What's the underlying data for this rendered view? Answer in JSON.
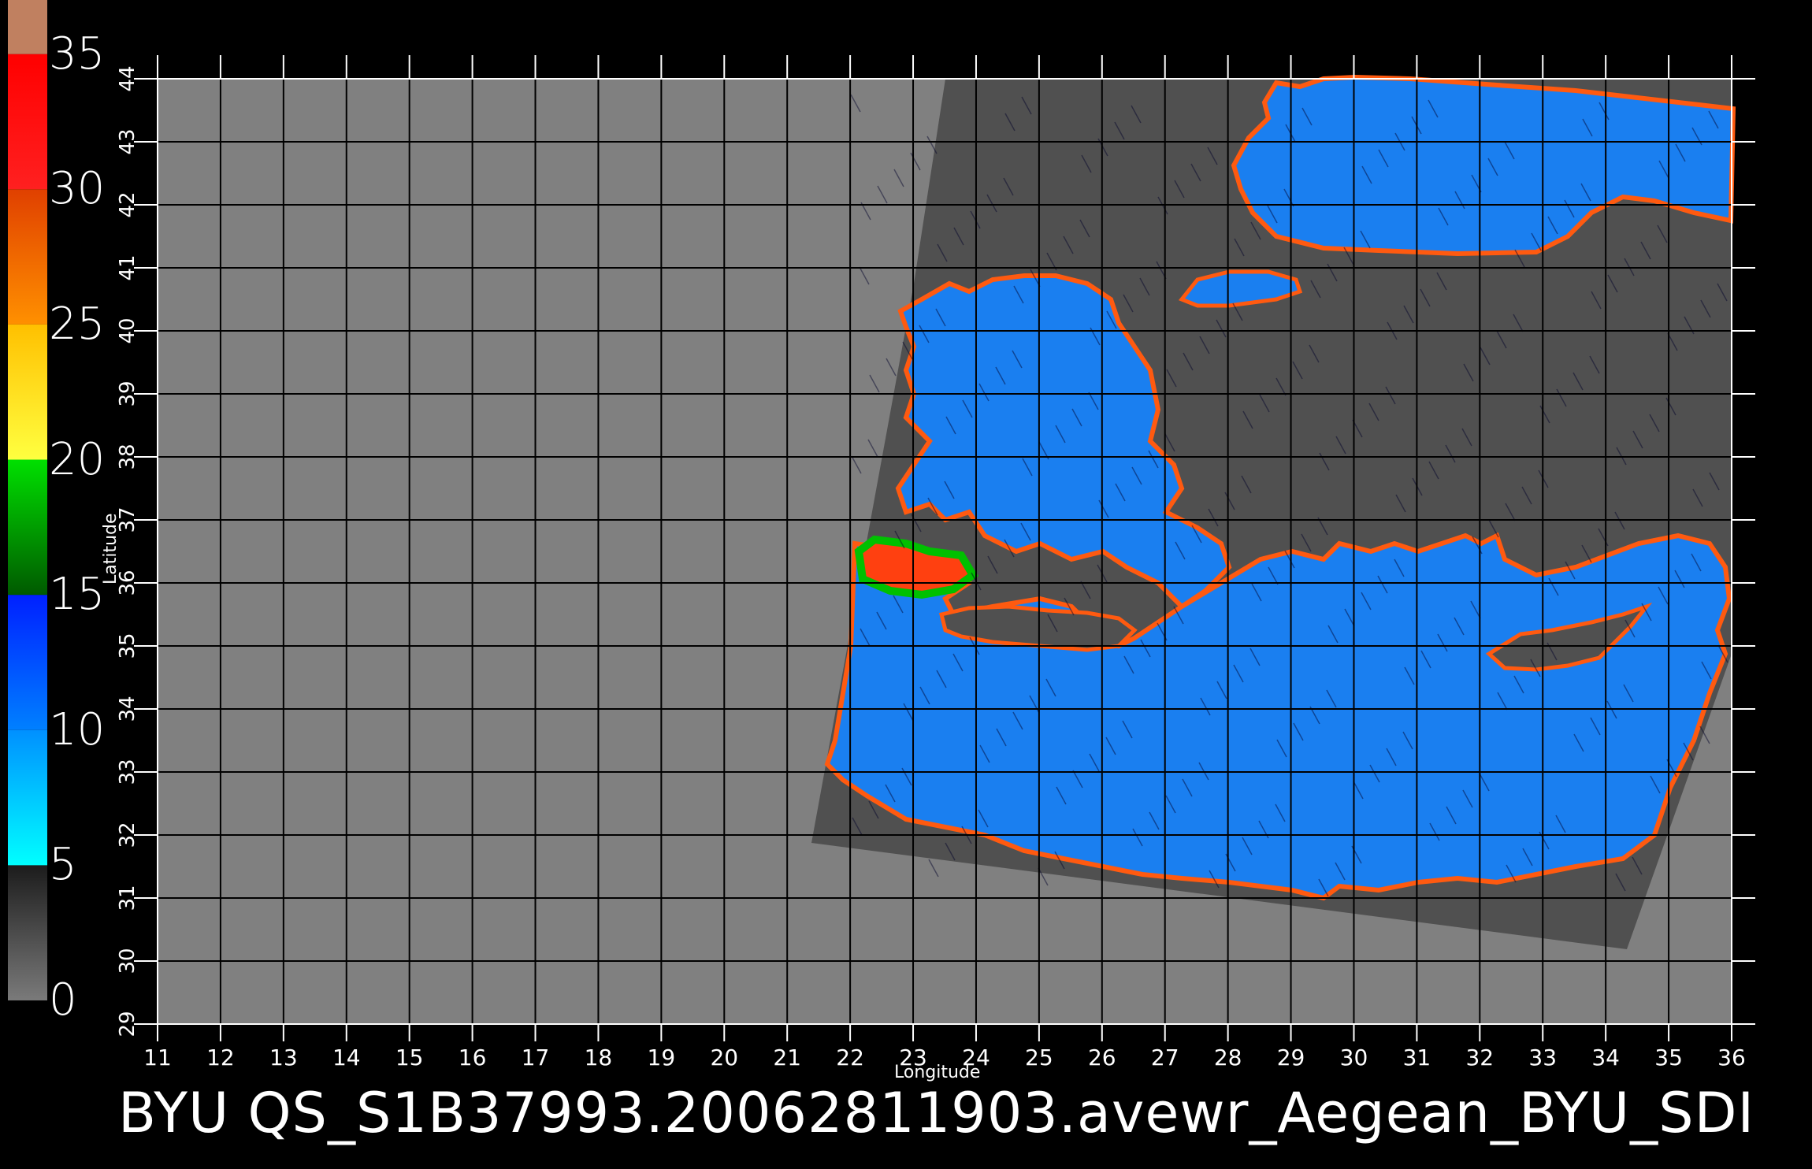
{
  "map": {
    "caption": "BYU  QS_S1B37993.20062811903.avewr_Aegean_BYU_SDI",
    "xaxis_title": "Longitude",
    "yaxis_title": "Latitude",
    "x_ticks": [
      "11",
      "12",
      "13",
      "14",
      "15",
      "16",
      "17",
      "18",
      "19",
      "20",
      "21",
      "22",
      "23",
      "24",
      "25",
      "26",
      "27",
      "28",
      "29",
      "30",
      "31",
      "32",
      "33",
      "34",
      "35",
      "36"
    ],
    "y_ticks": [
      "29",
      "30",
      "31",
      "32",
      "33",
      "34",
      "35",
      "36",
      "37",
      "38",
      "39",
      "40",
      "41",
      "42",
      "43",
      "44"
    ],
    "lon_range": [
      11,
      36
    ],
    "lat_range": [
      29,
      44
    ],
    "colorbar": {
      "labels": [
        "35",
        "30",
        "25",
        "20",
        "15",
        "10",
        "5",
        "0"
      ],
      "bands": [
        {
          "from": 0,
          "to": 5,
          "colors": [
            "#7a7a7a",
            "#1c1c1c"
          ]
        },
        {
          "from": 5,
          "to": 10,
          "colors": [
            "#00ffff",
            "#0090ff"
          ]
        },
        {
          "from": 10,
          "to": 15,
          "colors": [
            "#0080ff",
            "#0020ff"
          ]
        },
        {
          "from": 15,
          "to": 20,
          "colors": [
            "#005a00",
            "#00e000"
          ]
        },
        {
          "from": 20,
          "to": 25,
          "colors": [
            "#ffff40",
            "#ffc000"
          ]
        },
        {
          "from": 25,
          "to": 30,
          "colors": [
            "#ff9000",
            "#e04000"
          ]
        },
        {
          "from": 30,
          "to": 35,
          "colors": [
            "#ff2020",
            "#ff0000"
          ]
        },
        {
          "from": 35,
          "to": 37,
          "colors": [
            "#c08060",
            "#c08060"
          ]
        }
      ]
    },
    "colors": {
      "background": "#000000",
      "no_data": "#808080",
      "swath_no_data": "#505050",
      "grid": "#000000",
      "land_coast": "#ff4400"
    }
  }
}
